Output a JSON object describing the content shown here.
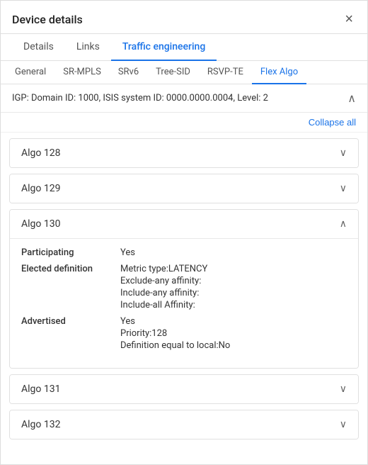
{
  "modal": {
    "title": "Device details",
    "close_label": "×"
  },
  "tabs_primary": {
    "items": [
      {
        "id": "details",
        "label": "Details",
        "active": false
      },
      {
        "id": "links",
        "label": "Links",
        "active": false
      },
      {
        "id": "traffic-engineering",
        "label": "Traffic engineering",
        "active": true
      }
    ]
  },
  "tabs_secondary": {
    "items": [
      {
        "id": "general",
        "label": "General",
        "active": false
      },
      {
        "id": "sr-mpls",
        "label": "SR-MPLS",
        "active": false
      },
      {
        "id": "srv6",
        "label": "SRv6",
        "active": false
      },
      {
        "id": "tree-sid",
        "label": "Tree-SID",
        "active": false
      },
      {
        "id": "rsvp-te",
        "label": "RSVP-TE",
        "active": false
      },
      {
        "id": "flex-algo",
        "label": "Flex Algo",
        "active": true
      }
    ]
  },
  "igp": {
    "text": "IGP: Domain ID: 1000, ISIS system ID: 0000.0000.0004, Level: 2"
  },
  "collapse_all_label": "Collapse all",
  "algos": [
    {
      "id": "algo-128",
      "title": "Algo 128",
      "expanded": false,
      "details": null
    },
    {
      "id": "algo-129",
      "title": "Algo 129",
      "expanded": false,
      "details": null
    },
    {
      "id": "algo-130",
      "title": "Algo 130",
      "expanded": true,
      "details": {
        "participating_label": "Participating",
        "participating_value": "Yes",
        "elected_label": "Elected definition",
        "elected_values": [
          "Metric type:LATENCY",
          "Exclude-any affinity:",
          "Include-any affinity:",
          "Include-all Affinity:"
        ],
        "advertised_label": "Advertised",
        "advertised_values": [
          "Yes",
          "Priority:128",
          "Definition equal to local:No"
        ]
      }
    },
    {
      "id": "algo-131",
      "title": "Algo 131",
      "expanded": false,
      "details": null
    },
    {
      "id": "algo-132",
      "title": "Algo 132",
      "expanded": false,
      "details": null
    }
  ],
  "icons": {
    "chevron_down": "∨",
    "chevron_up": "∧",
    "close": "✕"
  }
}
